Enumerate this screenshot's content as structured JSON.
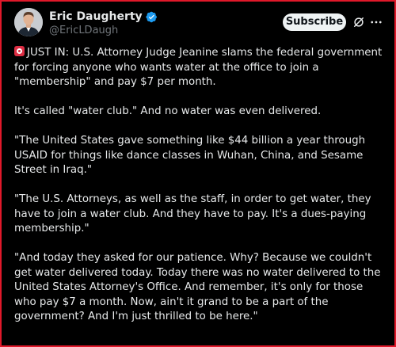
{
  "author": {
    "display_name": "Eric Daugherty",
    "handle": "@EricLDaugh",
    "verified_badge_icon": "verified-check-icon",
    "verified_color": "#1d9bf0"
  },
  "actions": {
    "subscribe_label": "Subscribe",
    "grok_icon": "grok-icon",
    "more_icon": "more-icon"
  },
  "post": {
    "lead_icon": "rotating-light-emoji",
    "paragraphs": [
      "JUST IN: U.S. Attorney Judge Jeanine slams the federal government for forcing anyone who wants water at the office to join a \"membership\" and pay $7 per month.",
      "It's called \"water club.\" And no water was even delivered.",
      "\"The United States gave something like $44 billion a year through USAID for things like dance classes in Wuhan, China, and Sesame Street in Iraq.\"",
      "\"The U.S. Attorneys, as well as the staff, in order to get water, they have to join a water club. And they have to pay. It's a dues-paying membership.\"",
      "\"And today they asked for our patience. Why? Because we couldn't get water delivered today. Today there was no water delivered to the United States Attorney's Office. And remember, it's only for those who pay $7 a month. Now, ain't it grand to be a part of the government? And I'm just thrilled to be here.\""
    ]
  },
  "colors": {
    "background": "#000000",
    "text": "#e7e9ea",
    "secondary_text": "#71767b",
    "frame_border": "#e0182a"
  }
}
